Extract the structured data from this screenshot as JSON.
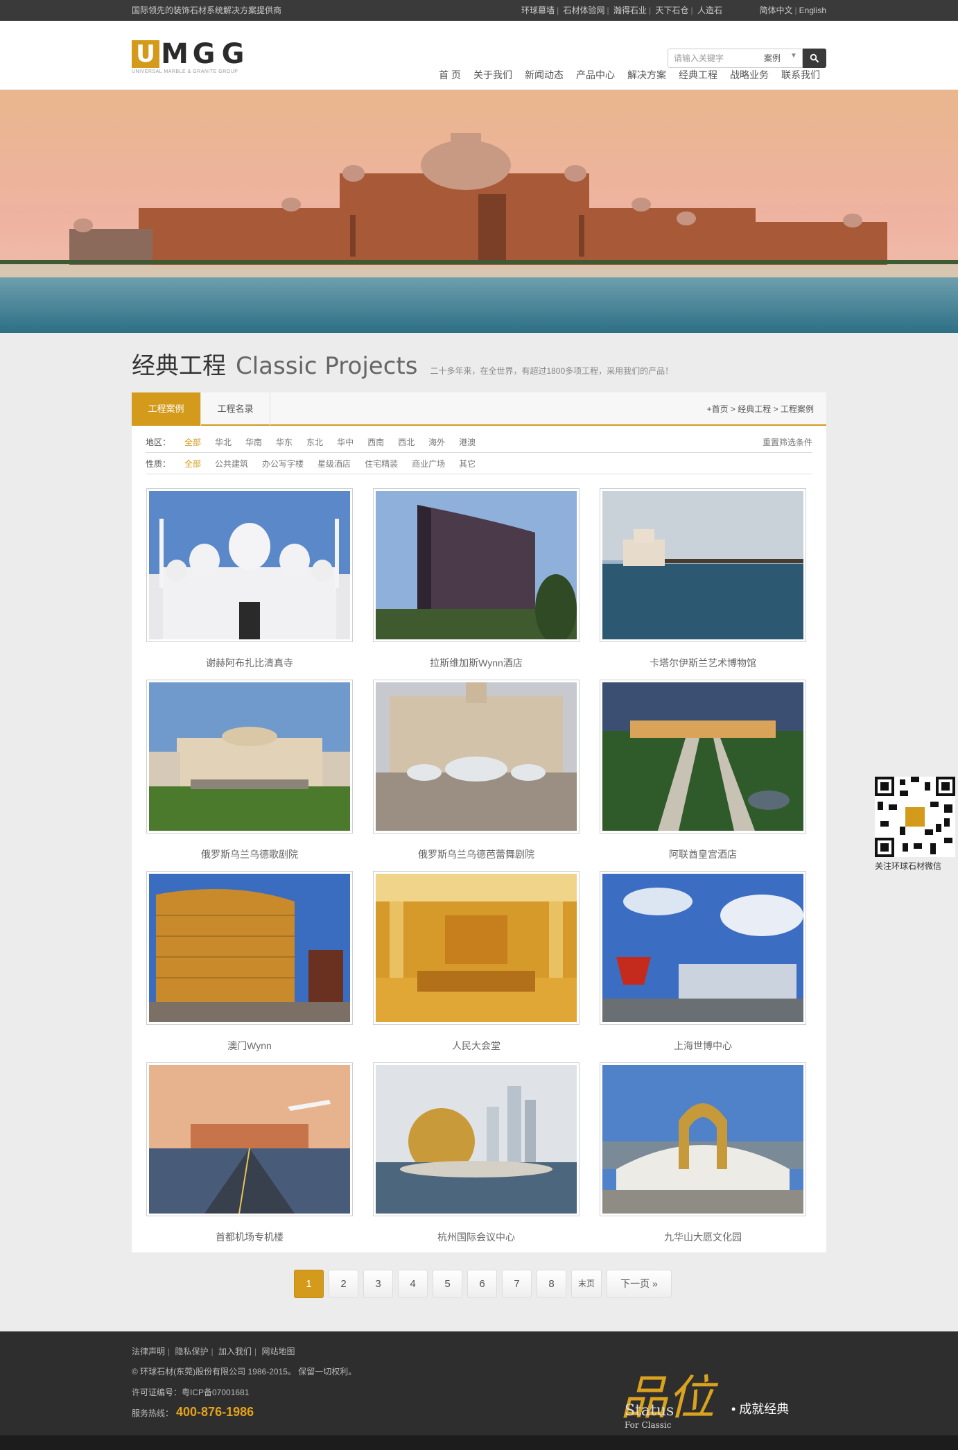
{
  "topbar": {
    "tagline": "国际领先的装饰石材系统解决方案提供商",
    "links": [
      "环球幕墙",
      "石材体验网",
      "瀚得石业",
      "天下石仓",
      "人造石"
    ],
    "languages": [
      "简体中文",
      "English"
    ]
  },
  "header": {
    "logo_text": "UMGG",
    "logo_subtitle": "UNIVERSAL MARBLE & GRANITE GROUP",
    "search_placeholder": "请输入关键字",
    "search_scope": "案例",
    "nav": [
      "首 页",
      "关于我们",
      "新闻动态",
      "产品中心",
      "解决方案",
      "经典工程",
      "战略业务",
      "联系我们"
    ]
  },
  "section": {
    "title_cn": "经典工程",
    "title_en": "Classic Projects",
    "description": "二十多年来，在全世界，有超过1800多项工程，采用我们的产品！"
  },
  "tabs": [
    "工程案例",
    "工程名录"
  ],
  "breadcrumb": [
    "+首页",
    "经典工程",
    "工程案例"
  ],
  "filters": {
    "region": {
      "label": "地区：",
      "options": [
        "全部",
        "华北",
        "华南",
        "华东",
        "东北",
        "华中",
        "西南",
        "西北",
        "海外",
        "港澳"
      ],
      "selected": "全部"
    },
    "type": {
      "label": "性质：",
      "options": [
        "全部",
        "公共建筑",
        "办公写字楼",
        "星级酒店",
        "住宅精装",
        "商业广场",
        "其它"
      ],
      "selected": "全部"
    },
    "reset": "重置筛选条件"
  },
  "projects": [
    {
      "name": "谢赫阿布扎比清真寺"
    },
    {
      "name": "拉斯维加斯Wynn酒店"
    },
    {
      "name": "卡塔尔伊斯兰艺术博物馆"
    },
    {
      "name": "俄罗斯乌兰乌德歌剧院"
    },
    {
      "name": "俄罗斯乌兰乌德芭蕾舞剧院"
    },
    {
      "name": "阿联酋皇宫酒店"
    },
    {
      "name": "澳门Wynn"
    },
    {
      "name": "人民大会堂"
    },
    {
      "name": "上海世博中心"
    },
    {
      "name": "首都机场专机楼"
    },
    {
      "name": "杭州国际会议中心"
    },
    {
      "name": "九华山大愿文化园"
    }
  ],
  "pagination": {
    "pages": [
      "1",
      "2",
      "3",
      "4",
      "5",
      "6",
      "7",
      "8"
    ],
    "current": "1",
    "last": "末页",
    "next": "下一页 »"
  },
  "qr": {
    "caption": "关注环球石材微信"
  },
  "footer": {
    "links": [
      "法律声明",
      "隐私保护",
      "加入我们",
      "网站地图"
    ],
    "copyright": "© 环球石材(东莞)股份有限公司 1986-2015。 保留一切权利。",
    "icp": "许可证编号：粤ICP备07001681",
    "hotline_label": "服务热线：",
    "hotline": "400-876-1986",
    "slogan_big": "品位",
    "slogan_status": "Status",
    "slogan_classic": "For Classic",
    "slogan_cn": "• 成就经典"
  },
  "colors": {
    "accent": "#d39a1b",
    "topbar": "#3a3a3a",
    "footer": "#2e2e2e"
  }
}
